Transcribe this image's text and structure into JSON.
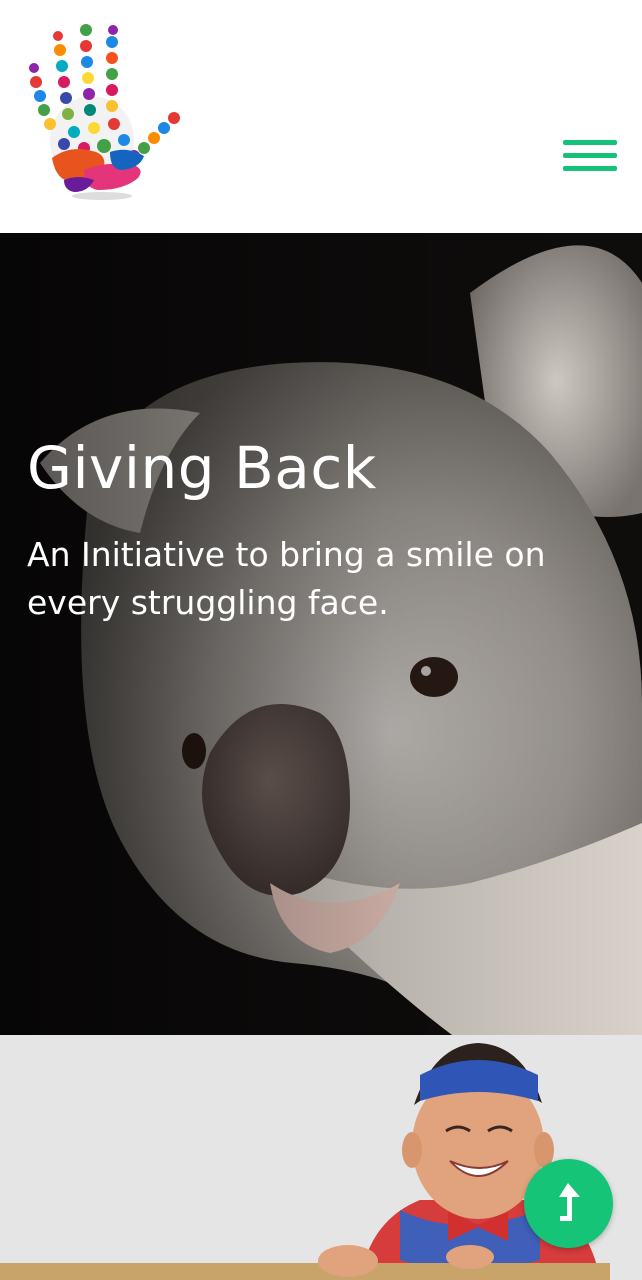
{
  "header": {
    "logo_icon": "colorful-handprint-hand-logo",
    "menu_icon": "hamburger-menu-icon",
    "accent_color": "#15c27a"
  },
  "hero": {
    "title": "Giving Back",
    "subtitle": "An Initiative to bring a smile on every struggling face.",
    "background_image": "koala-closeup-photo"
  },
  "promo": {
    "background_image": "smiling-child-superhero-costume-photo"
  },
  "back_to_top": {
    "icon": "arrow-up-icon",
    "color": "#16c477"
  }
}
